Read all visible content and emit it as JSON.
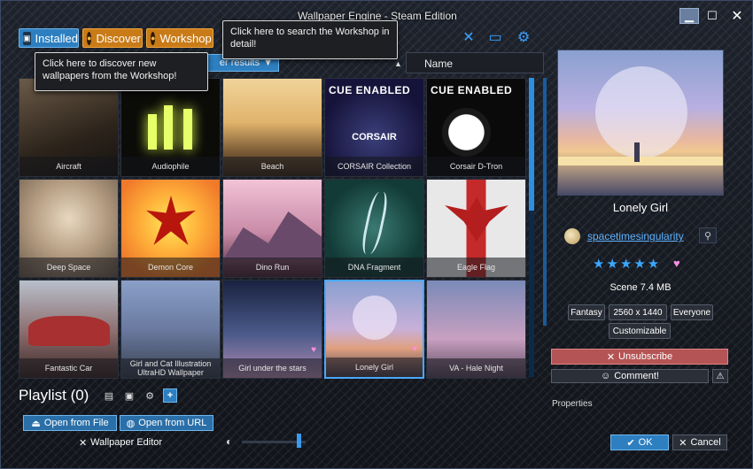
{
  "window": {
    "title": "Wallpaper Engine - Steam Edition"
  },
  "tabs": {
    "installed": "Installed",
    "discover": "Discover",
    "workshop": "Workshop"
  },
  "tooltips": {
    "discover": "Click here to discover new wallpapers from the Workshop!",
    "workshop": "Click here to search the Workshop in detail!"
  },
  "filter": {
    "button_label": "er results",
    "sort_field": "Name"
  },
  "wallpapers": [
    {
      "title": "Aircraft"
    },
    {
      "title": "Audiophile"
    },
    {
      "title": "Beach"
    },
    {
      "title": "CORSAIR Collection",
      "badge": "CUE ENABLED",
      "brand": "CORSAIR"
    },
    {
      "title": "Corsair D-Tron",
      "badge": "CUE ENABLED"
    },
    {
      "title": "Deep Space"
    },
    {
      "title": "Demon Core"
    },
    {
      "title": "Dino Run"
    },
    {
      "title": "DNA Fragment"
    },
    {
      "title": "Eagle Flag"
    },
    {
      "title": "Fantastic Car"
    },
    {
      "title": "Girl and Cat Illustration UltraHD Wallpaper"
    },
    {
      "title": "Girl under the stars"
    },
    {
      "title": "Lonely Girl"
    },
    {
      "title": "VA - Hale Night"
    }
  ],
  "playlist": {
    "title": "Playlist (0)",
    "open_file": "Open from File",
    "open_url": "Open from URL",
    "editor": "Wallpaper Editor",
    "volume": 0.9
  },
  "details": {
    "title": "Lonely Girl",
    "author": "spacetimesingularity",
    "rating": "★★★★★",
    "meta": "Scene 7.4 MB",
    "tags": [
      "Fantasy",
      "2560 x 1440",
      "Everyone",
      "Customizable"
    ],
    "unsubscribe": "Unsubscribe",
    "comment": "Comment!",
    "properties": "Properties",
    "ok": "OK",
    "cancel": "Cancel"
  },
  "colors": {
    "accent_blue": "#2d7fc0",
    "accent_orange": "#c97b17",
    "unsubscribe_red": "#b55454",
    "link_blue": "#5fb2ff"
  }
}
